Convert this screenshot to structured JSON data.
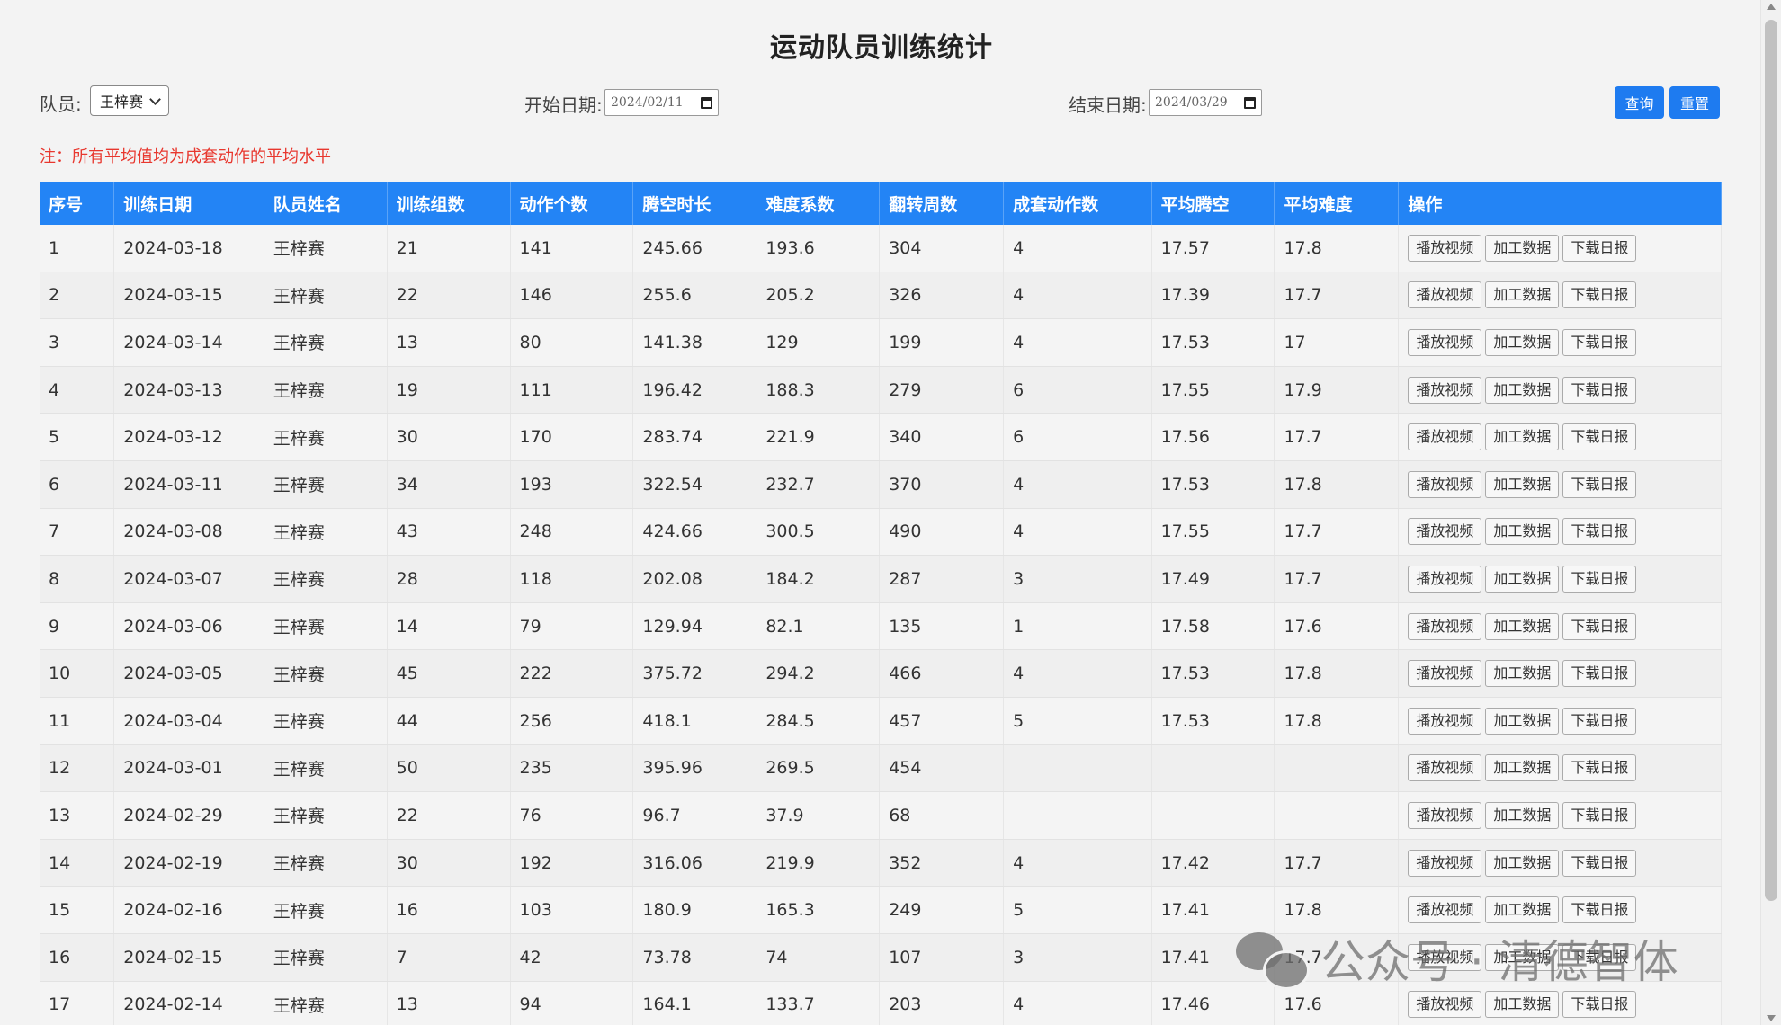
{
  "page": {
    "title": "运动队员训练统计"
  },
  "filters": {
    "player_label": "队员:",
    "player_value": "王梓赛",
    "start_label": "开始日期:",
    "start_value": "2024/02/11",
    "end_label": "结束日期:",
    "end_value": "2024/03/29",
    "query_label": "查询",
    "reset_label": "重置"
  },
  "note": "注：所有平均值均为成套动作的平均水平",
  "table": {
    "headers": [
      "序号",
      "训练日期",
      "队员姓名",
      "训练组数",
      "动作个数",
      "腾空时长",
      "难度系数",
      "翻转周数",
      "成套动作数",
      "平均腾空",
      "平均难度",
      "操作"
    ],
    "op_labels": [
      "播放视频",
      "加工数据",
      "下载日报"
    ],
    "rows": [
      [
        "1",
        "2024-03-18",
        "王梓赛",
        "21",
        "141",
        "245.66",
        "193.6",
        "304",
        "4",
        "17.57",
        "17.8"
      ],
      [
        "2",
        "2024-03-15",
        "王梓赛",
        "22",
        "146",
        "255.6",
        "205.2",
        "326",
        "4",
        "17.39",
        "17.7"
      ],
      [
        "3",
        "2024-03-14",
        "王梓赛",
        "13",
        "80",
        "141.38",
        "129",
        "199",
        "4",
        "17.53",
        "17"
      ],
      [
        "4",
        "2024-03-13",
        "王梓赛",
        "19",
        "111",
        "196.42",
        "188.3",
        "279",
        "6",
        "17.55",
        "17.9"
      ],
      [
        "5",
        "2024-03-12",
        "王梓赛",
        "30",
        "170",
        "283.74",
        "221.9",
        "340",
        "6",
        "17.56",
        "17.7"
      ],
      [
        "6",
        "2024-03-11",
        "王梓赛",
        "34",
        "193",
        "322.54",
        "232.7",
        "370",
        "4",
        "17.53",
        "17.8"
      ],
      [
        "7",
        "2024-03-08",
        "王梓赛",
        "43",
        "248",
        "424.66",
        "300.5",
        "490",
        "4",
        "17.55",
        "17.7"
      ],
      [
        "8",
        "2024-03-07",
        "王梓赛",
        "28",
        "118",
        "202.08",
        "184.2",
        "287",
        "3",
        "17.49",
        "17.7"
      ],
      [
        "9",
        "2024-03-06",
        "王梓赛",
        "14",
        "79",
        "129.94",
        "82.1",
        "135",
        "1",
        "17.58",
        "17.6"
      ],
      [
        "10",
        "2024-03-05",
        "王梓赛",
        "45",
        "222",
        "375.72",
        "294.2",
        "466",
        "4",
        "17.53",
        "17.8"
      ],
      [
        "11",
        "2024-03-04",
        "王梓赛",
        "44",
        "256",
        "418.1",
        "284.5",
        "457",
        "5",
        "17.53",
        "17.8"
      ],
      [
        "12",
        "2024-03-01",
        "王梓赛",
        "50",
        "235",
        "395.96",
        "269.5",
        "454",
        "",
        "",
        ""
      ],
      [
        "13",
        "2024-02-29",
        "王梓赛",
        "22",
        "76",
        "96.7",
        "37.9",
        "68",
        "",
        "",
        ""
      ],
      [
        "14",
        "2024-02-19",
        "王梓赛",
        "30",
        "192",
        "316.06",
        "219.9",
        "352",
        "4",
        "17.42",
        "17.7"
      ],
      [
        "15",
        "2024-02-16",
        "王梓赛",
        "16",
        "103",
        "180.9",
        "165.3",
        "249",
        "5",
        "17.41",
        "17.8"
      ],
      [
        "16",
        "2024-02-15",
        "王梓赛",
        "7",
        "42",
        "73.78",
        "74",
        "107",
        "3",
        "17.41",
        "17.7"
      ],
      [
        "17",
        "2024-02-14",
        "王梓赛",
        "13",
        "94",
        "164.1",
        "133.7",
        "203",
        "4",
        "17.46",
        "17.6"
      ]
    ]
  },
  "watermark": "公众号 · 清德智体",
  "colors": {
    "header_bg": "#2384f5",
    "primary_button": "#1e7bf0",
    "note_text": "#e8372e"
  },
  "icons": {
    "select_arrow": "chevron-down-icon",
    "date_picker": "calendar-icon",
    "watermark_logo": "wechat-icon"
  }
}
